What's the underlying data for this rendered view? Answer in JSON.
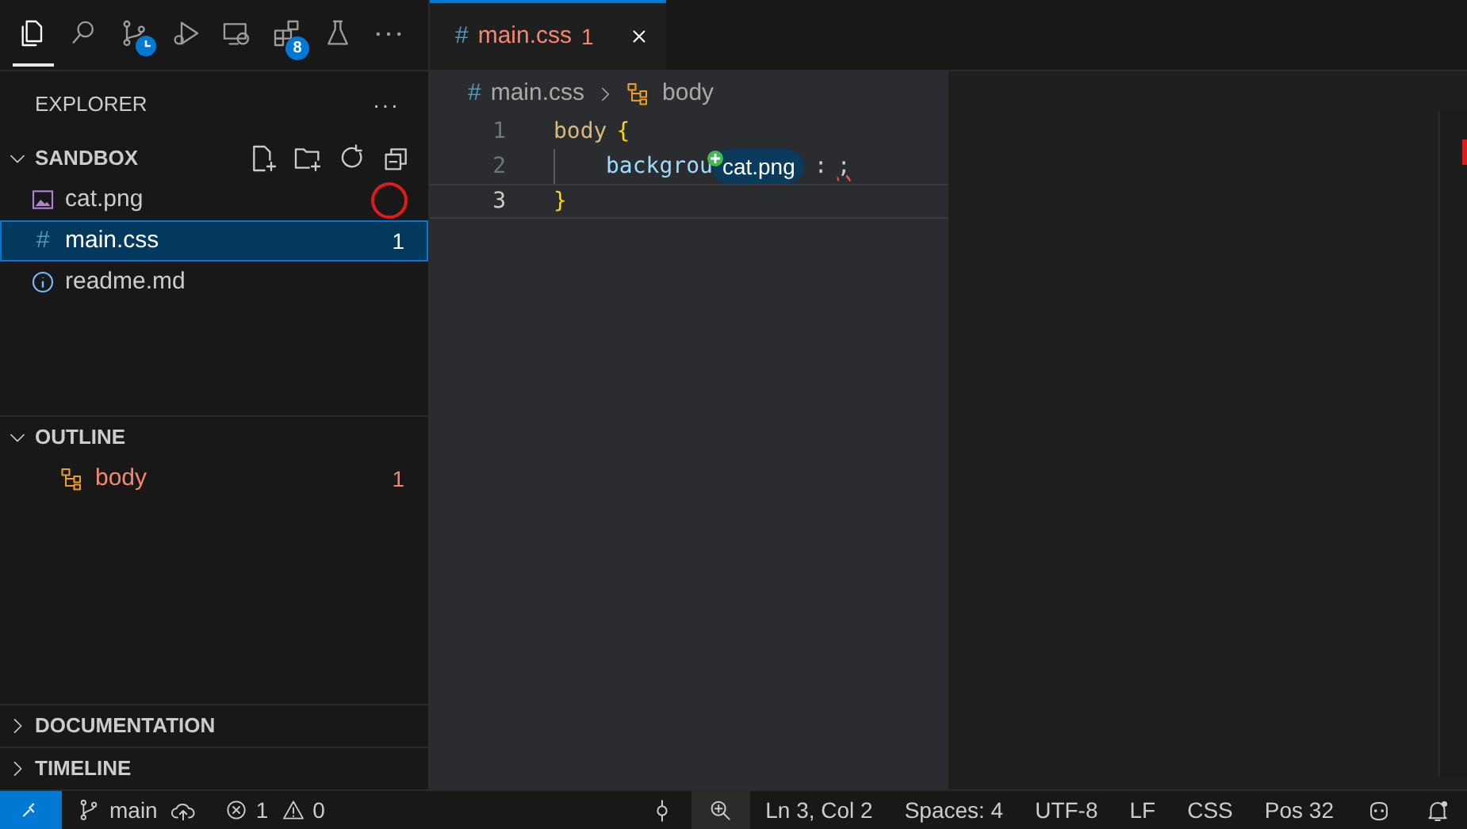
{
  "activity_bar": [
    {
      "kind": "files",
      "selected": true
    },
    {
      "kind": "search",
      "selected": false
    },
    {
      "kind": "scm",
      "selected": false,
      "clock": true
    },
    {
      "kind": "run",
      "selected": false
    },
    {
      "kind": "remote",
      "selected": false
    },
    {
      "kind": "extensions",
      "selected": false,
      "badge": "8"
    },
    {
      "kind": "testing",
      "selected": false
    },
    {
      "kind": "more",
      "selected": false
    }
  ],
  "sidebar": {
    "title": "EXPLORER",
    "more": "···",
    "sections": [
      {
        "title": "SANDBOX",
        "expanded": true,
        "kind": "files",
        "items": [
          {
            "kind": "image",
            "name": "cat.png",
            "selected": false
          },
          {
            "kind": "css",
            "icon": "#",
            "name": "main.css",
            "selected": true,
            "problems": "1"
          },
          {
            "kind": "info",
            "name": "readme.md",
            "selected": false
          }
        ]
      },
      {
        "title": "OUTLINE",
        "expanded": true,
        "kind": "outline",
        "items": [
          {
            "kind": "symbol",
            "name": "body",
            "selected": false,
            "problems": "1"
          }
        ]
      },
      {
        "title": "DOCUMENTATION",
        "expanded": false,
        "kind": "docs"
      },
      {
        "title": "TIMELINE",
        "expanded": false,
        "kind": "timeline"
      }
    ]
  },
  "tabs": [
    {
      "icon": "#",
      "label": "main.css",
      "problems": "1",
      "selected": true,
      "error": true
    }
  ],
  "breadcrumb": [
    {
      "kind": "file",
      "icon": "#",
      "text": "main.css"
    },
    {
      "kind": "symbol",
      "text": "body"
    }
  ],
  "code": [
    {
      "number": "1",
      "current": false,
      "tokens": [
        {
          "kind": "selector",
          "text": "body"
        },
        {
          "kind": "brace",
          "text": "{"
        }
      ]
    },
    {
      "number": "2",
      "current": false,
      "tokens": [
        {
          "kind": "property",
          "text": "backgrou"
        },
        {
          "kind": "drag",
          "text": "cat.png"
        },
        {
          "kind": "punct",
          "text": ":",
          "error": false
        },
        {
          "kind": "punct",
          "text": ";",
          "error": true
        }
      ]
    },
    {
      "number": "3",
      "current": true,
      "tokens": [
        {
          "kind": "brace",
          "text": "}"
        }
      ]
    }
  ],
  "status_bar": {
    "left": [
      {
        "kind": "remote"
      },
      {
        "kind": "branch",
        "text": "main"
      },
      {
        "kind": "problems",
        "errors": "1",
        "warnings": "0"
      }
    ],
    "right": [
      {
        "kind": "commit",
        "active": false
      },
      {
        "kind": "zoom",
        "active": true
      },
      {
        "kind": "text",
        "text": "Ln 3, Col 2"
      },
      {
        "kind": "text",
        "text": "Spaces: 4"
      },
      {
        "kind": "text",
        "text": "UTF-8"
      },
      {
        "kind": "text",
        "text": "LF"
      },
      {
        "kind": "text",
        "text": "CSS"
      },
      {
        "kind": "text",
        "text": "Pos 32"
      },
      {
        "kind": "copilot",
        "active": false
      },
      {
        "kind": "bell",
        "active": false
      }
    ]
  }
}
